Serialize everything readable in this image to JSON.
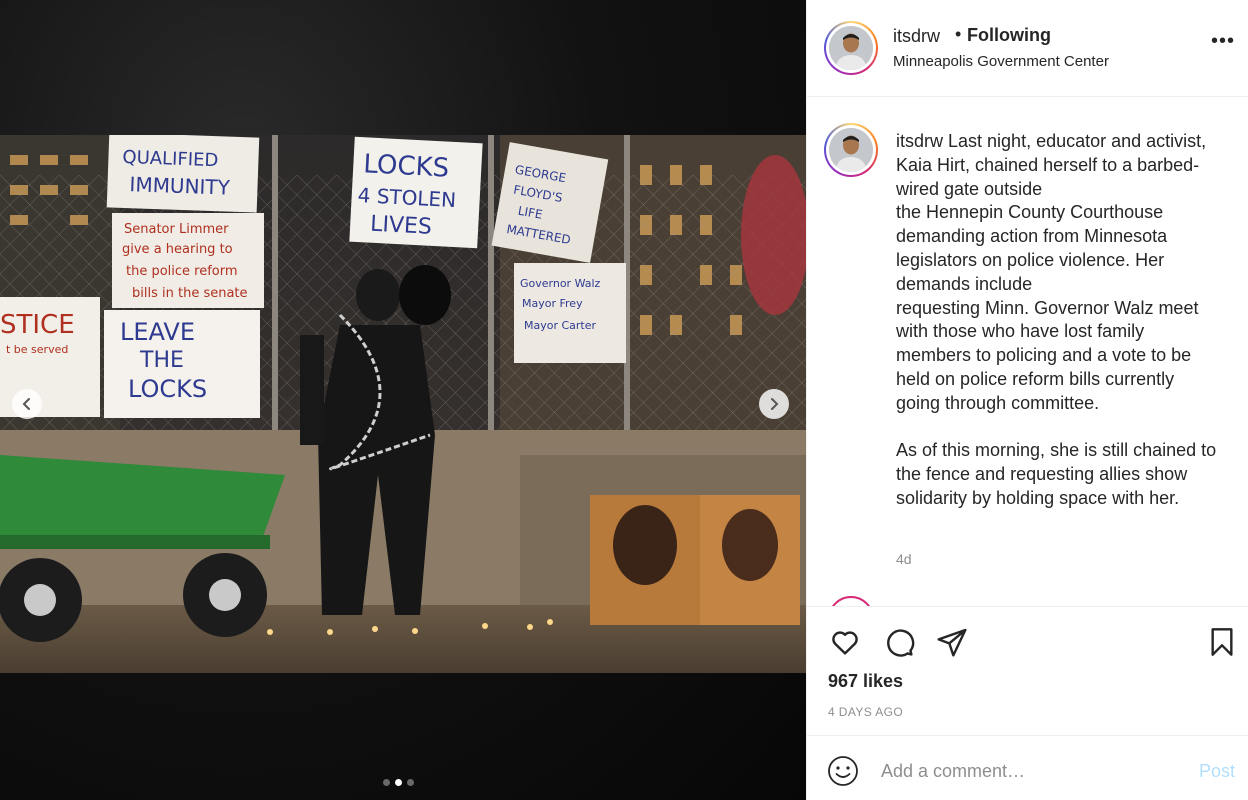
{
  "post": {
    "username": "itsdrw",
    "separator": "•",
    "follow_status": "Following",
    "location": "Minneapolis Government Center",
    "more_label": "•••"
  },
  "media": {
    "slide_count": 3,
    "active_slide": 2,
    "sign_texts": [
      "QUALIFIED IMMUNITY",
      "LOCKS 4 STOLEN LIVES",
      "GEORGE FLOYD'S LIFE MATTERED",
      "Senator Limmer give a hearing to the police reform bills in the senate",
      "LEAVE THE LOCKS",
      "Governor Walz Mayor Frey Mayor Carter",
      "JUSTICE"
    ]
  },
  "caption": {
    "username": "itsdrw",
    "text": " Last night, educator and activist, Kaia Hirt, chained herself to a barbed-wired gate outside\nthe Hennepin County Courthouse demanding action from Minnesota legislators on police violence. Her demands include\nrequesting Minn. Governor Walz meet with those who have lost family members to policing and a vote to be held on police reform bills currently going through committee.\n\nAs of this morning, she is still chained to the fence and requesting allies show solidarity by holding space with her.",
    "time_ago": "4d"
  },
  "actions": {
    "likes": "967 likes",
    "date": "4 DAYS AGO",
    "icons": [
      "heart-icon",
      "comment-icon",
      "share-icon",
      "bookmark-icon"
    ]
  },
  "comment_box": {
    "placeholder": "Add a comment…",
    "post_label": "Post"
  },
  "colors": {
    "text": "#262626",
    "secondary": "#8e8e8e",
    "border": "#efefef",
    "post_disabled": "#b2dffc"
  }
}
